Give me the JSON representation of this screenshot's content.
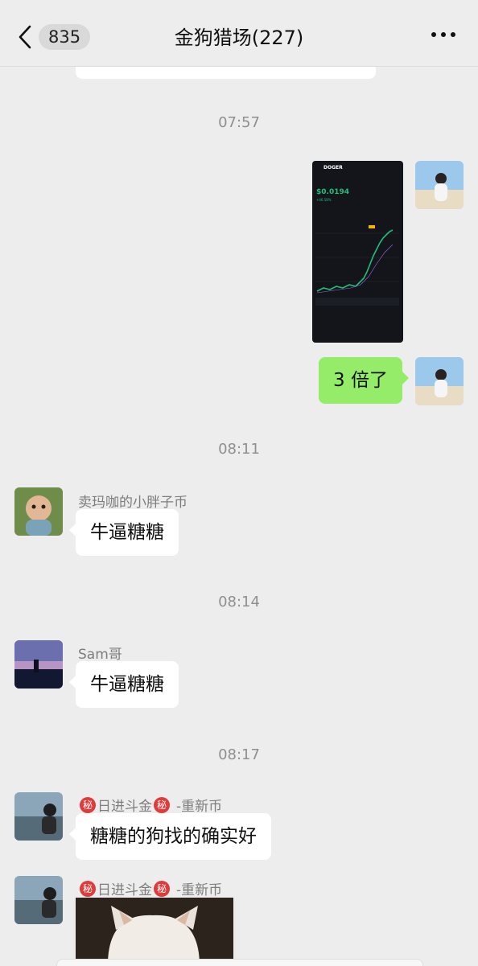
{
  "header": {
    "back_badge": "835",
    "title": "金狗猎场(227)"
  },
  "timestamps": [
    "07:57",
    "08:11",
    "08:14",
    "08:17"
  ],
  "messages": [
    {
      "side": "right",
      "type": "image",
      "content": "chart-screenshot"
    },
    {
      "side": "right",
      "type": "text",
      "text": "3 倍了"
    },
    {
      "side": "left",
      "sender": "卖玛咖的小胖子币",
      "text": "牛逼糖糖"
    },
    {
      "side": "left",
      "sender": "Sam哥",
      "text": "牛逼糖糖"
    },
    {
      "side": "left",
      "sender_prefix": "日进斗金",
      "sender_suffix": "-重新币",
      "badge": "秘",
      "text": "糖糖的狗找的确实好"
    },
    {
      "side": "left",
      "sender_prefix": "日进斗金",
      "sender_suffix": "-重新币",
      "badge": "秘",
      "type": "image",
      "content": "dog-photo"
    }
  ],
  "screenshot": {
    "symbol": "DOGER",
    "price": "$0.0194",
    "change": "+46.58%"
  },
  "colors": {
    "background": "#ededed",
    "own_bubble": "#95ec69",
    "other_bubble": "#ffffff",
    "secret_badge": "#e03b3b"
  },
  "icons": [
    "back-chevron-icon",
    "more-dots-icon"
  ]
}
